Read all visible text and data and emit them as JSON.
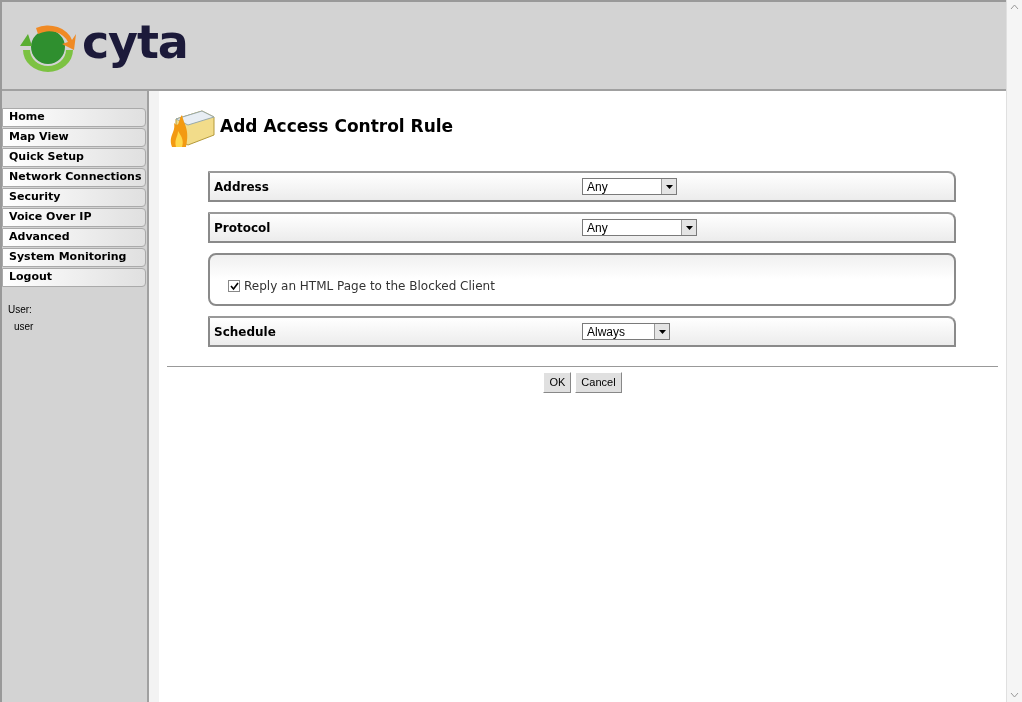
{
  "header": {
    "logo_text": "cyta"
  },
  "sidebar": {
    "items": [
      {
        "label": "Home"
      },
      {
        "label": "Map View"
      },
      {
        "label": "Quick Setup"
      },
      {
        "label": "Network Connections"
      },
      {
        "label": "Security"
      },
      {
        "label": "Voice Over IP"
      },
      {
        "label": "Advanced"
      },
      {
        "label": "System Monitoring"
      },
      {
        "label": "Logout"
      }
    ],
    "user_label": "User:",
    "user_name": "user"
  },
  "page": {
    "title": "Add Access Control Rule",
    "rows": [
      {
        "kind": "select",
        "label": "Address",
        "value": "Any"
      },
      {
        "kind": "select",
        "label": "Protocol",
        "value": "Any"
      },
      {
        "kind": "checkbox",
        "label": "Reply an HTML Page to the Blocked Client",
        "checked": true
      },
      {
        "kind": "select",
        "label": "Schedule",
        "value": "Always"
      }
    ],
    "buttons": [
      "OK",
      "Cancel"
    ]
  }
}
